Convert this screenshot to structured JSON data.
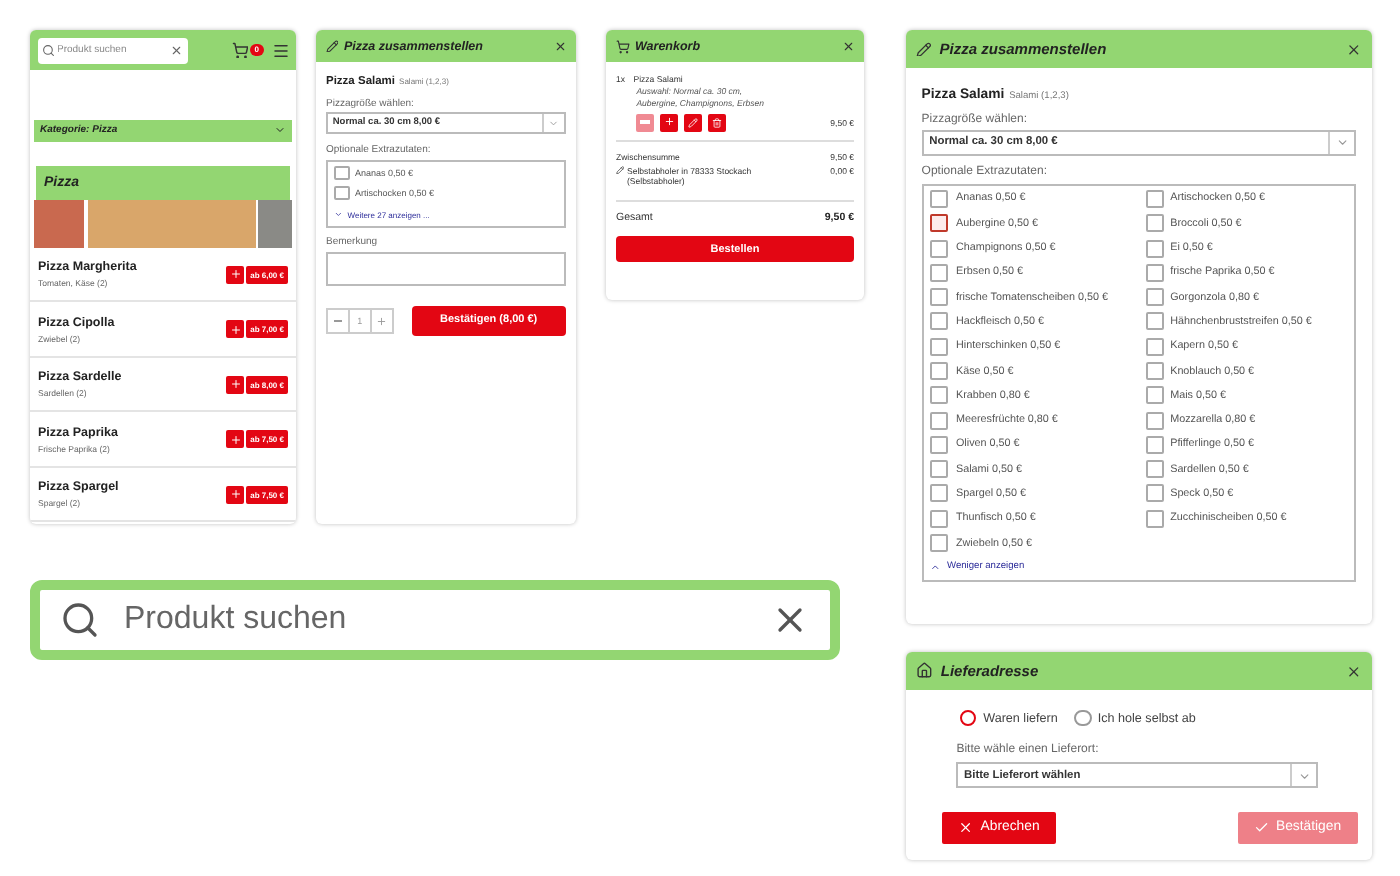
{
  "mobile_menu": {
    "search": {
      "placeholder": "Produkt suchen"
    },
    "cart_count": "0",
    "category": "Kategorie: Pizza",
    "section_title": "Pizza",
    "products": [
      {
        "name": "Pizza Margherita",
        "ingredients": "Tomaten, Käse (2)",
        "price": "ab 6,00 €"
      },
      {
        "name": "Pizza Cipolla",
        "ingredients": "Zwiebel (2)",
        "price": "ab 7,00 €"
      },
      {
        "name": "Pizza Sardelle",
        "ingredients": "Sardellen (2)",
        "price": "ab 8,00 €"
      },
      {
        "name": "Pizza Paprika",
        "ingredients": "Frische Paprika (2)",
        "price": "ab 7,50 €"
      },
      {
        "name": "Pizza Spargel",
        "ingredients": "Spargel (2)",
        "price": "ab 7,50 €"
      }
    ]
  },
  "composer_small": {
    "title": "Pizza zusammenstellen",
    "product": "Pizza Salami",
    "product_note": "Salami (1,2,3)",
    "size_label": "Pizzagröße wählen:",
    "size_value": "Normal ca. 30 cm 8,00 €",
    "extras_label": "Optionale Extrazutaten:",
    "extras": [
      {
        "label": "Ananas 0,50 €",
        "checked": false,
        "focused": false
      },
      {
        "label": "Artischocken 0,50 €",
        "checked": false,
        "focused": false
      }
    ],
    "toggle": "Weitere 27 anzeigen ...",
    "expanded": false,
    "remark_label": "Bemerkung",
    "quantity": "1",
    "confirm": "Bestätigen (8,00 €)"
  },
  "cart": {
    "title": "Warenkorb",
    "items": [
      {
        "quantity": "1x",
        "name": "Pizza Salami",
        "details": "Auswahl: Normal ca. 30 cm, Aubergine, Champignons, Erbsen",
        "price": "9,50 €"
      }
    ],
    "subtotal_label": "Zwischensumme",
    "subtotal": "9,50 €",
    "pickup_label": "Selbstabholer in 78333 Stockach (Selbstabholer)",
    "pickup_price": "0,00 €",
    "total_label": "Gesamt",
    "total": "9,50 €",
    "order": "Bestellen"
  },
  "composer_large": {
    "title": "Pizza zusammenstellen",
    "product": "Pizza Salami",
    "product_note": "Salami (1,2,3)",
    "size_label": "Pizzagröße wählen:",
    "size_value": "Normal ca. 30 cm 8,00 €",
    "extras_label": "Optionale Extrazutaten:",
    "extras": [
      {
        "label": "Ananas 0,50 €",
        "checked": false,
        "focused": false
      },
      {
        "label": "Artischocken 0,50 €",
        "checked": false,
        "focused": false
      },
      {
        "label": "Aubergine 0,50 €",
        "checked": false,
        "focused": true
      },
      {
        "label": "Broccoli 0,50 €",
        "checked": false,
        "focused": false
      },
      {
        "label": "Champignons 0,50 €",
        "checked": false,
        "focused": false
      },
      {
        "label": "Ei 0,50 €",
        "checked": false,
        "focused": false
      },
      {
        "label": "Erbsen 0,50 €",
        "checked": false,
        "focused": false
      },
      {
        "label": "frische Paprika 0,50 €",
        "checked": false,
        "focused": false
      },
      {
        "label": "frische Tomatenscheiben 0,50 €",
        "checked": false,
        "focused": false
      },
      {
        "label": "Gorgonzola 0,80 €",
        "checked": false,
        "focused": false
      },
      {
        "label": "Hackfleisch 0,50 €",
        "checked": false,
        "focused": false
      },
      {
        "label": "Hähnchenbruststreifen 0,50 €",
        "checked": false,
        "focused": false
      },
      {
        "label": "Hinterschinken 0,50 €",
        "checked": false,
        "focused": false
      },
      {
        "label": "Kapern 0,50 €",
        "checked": false,
        "focused": false
      },
      {
        "label": "Käse 0,50 €",
        "checked": false,
        "focused": false
      },
      {
        "label": "Knoblauch 0,50 €",
        "checked": false,
        "focused": false
      },
      {
        "label": "Krabben 0,80 €",
        "checked": false,
        "focused": false
      },
      {
        "label": "Mais 0,50 €",
        "checked": false,
        "focused": false
      },
      {
        "label": "Meeresfrüchte 0,80 €",
        "checked": false,
        "focused": false
      },
      {
        "label": "Mozzarella 0,80 €",
        "checked": false,
        "focused": false
      },
      {
        "label": "Oliven 0,50 €",
        "checked": false,
        "focused": false
      },
      {
        "label": "Pfifferlinge 0,50 €",
        "checked": false,
        "focused": false
      },
      {
        "label": "Salami 0,50 €",
        "checked": false,
        "focused": false
      },
      {
        "label": "Sardellen 0,50 €",
        "checked": false,
        "focused": false
      },
      {
        "label": "Spargel 0,50 €",
        "checked": false,
        "focused": false
      },
      {
        "label": "Speck 0,50 €",
        "checked": false,
        "focused": false
      },
      {
        "label": "Thunfisch 0,50 €",
        "checked": false,
        "focused": false
      },
      {
        "label": "Zucchinischeiben 0,50 €",
        "checked": false,
        "focused": false
      },
      {
        "label": "Zwiebeln 0,50 €",
        "checked": false,
        "focused": false
      }
    ],
    "toggle": "Weniger anzeigen",
    "expanded": true
  },
  "search_large": {
    "placeholder": "Produkt suchen"
  },
  "delivery": {
    "title": "Lieferadresse",
    "options": [
      {
        "label": "Waren liefern",
        "selected": true
      },
      {
        "label": "Ich hole selbst ab",
        "selected": false
      }
    ],
    "location_label": "Bitte wähle einen Lieferort:",
    "location_value": "Bitte Lieferort wählen",
    "buttons": [
      {
        "kind": "cancel",
        "label": "Abrechen",
        "disabled": false
      },
      {
        "kind": "confirm",
        "label": "Bestätigen",
        "disabled": true
      }
    ]
  }
}
